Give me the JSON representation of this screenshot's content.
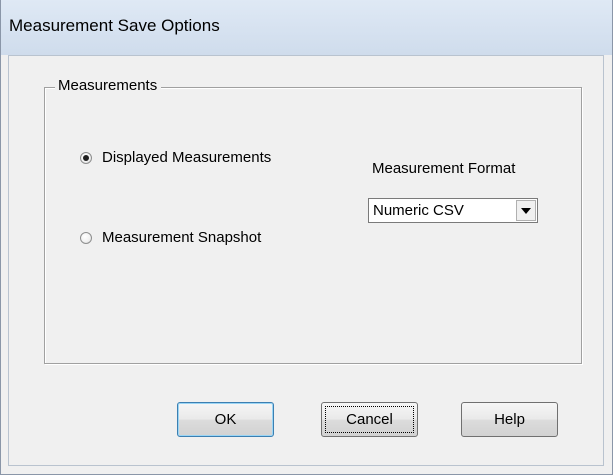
{
  "dialog": {
    "title": "Measurement Save Options"
  },
  "group": {
    "legend": "Measurements"
  },
  "options": [
    {
      "label": "Displayed Measurements",
      "checked": true
    },
    {
      "label": "Measurement Snapshot",
      "checked": false
    }
  ],
  "format": {
    "label": "Measurement Format",
    "value": "Numeric CSV"
  },
  "buttons": {
    "ok": "OK",
    "cancel": "Cancel",
    "help": "Help"
  }
}
